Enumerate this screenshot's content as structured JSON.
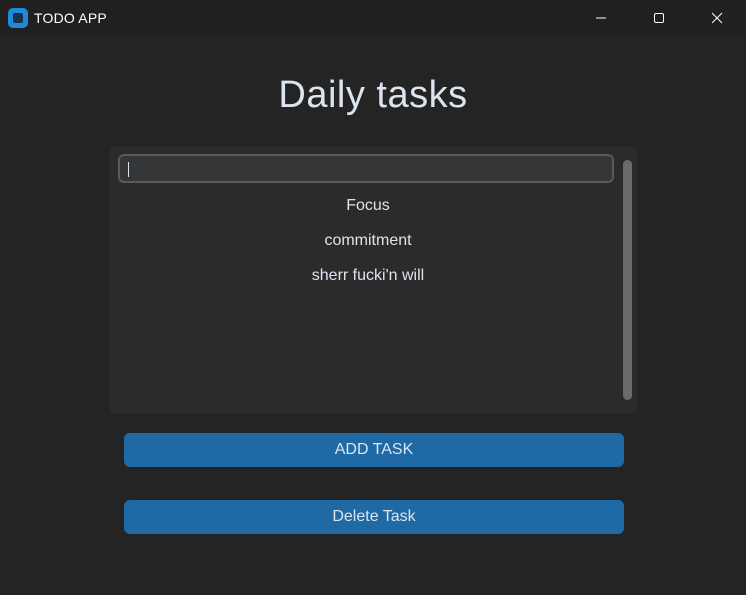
{
  "window": {
    "title": "TODO APP",
    "controls": [
      "minimize-icon",
      "maximize-icon",
      "close-icon"
    ],
    "app_icon": "app-icon",
    "accent_color": "#1f8bd6"
  },
  "main": {
    "heading": "Daily tasks",
    "input": {
      "value": "",
      "placeholder": ""
    },
    "tasks": [
      "Focus",
      "commitment",
      "sherr fucki'n will"
    ],
    "buttons": {
      "add_label": "ADD TASK",
      "delete_label": "Delete Task",
      "color": "#1f6aa5"
    }
  }
}
